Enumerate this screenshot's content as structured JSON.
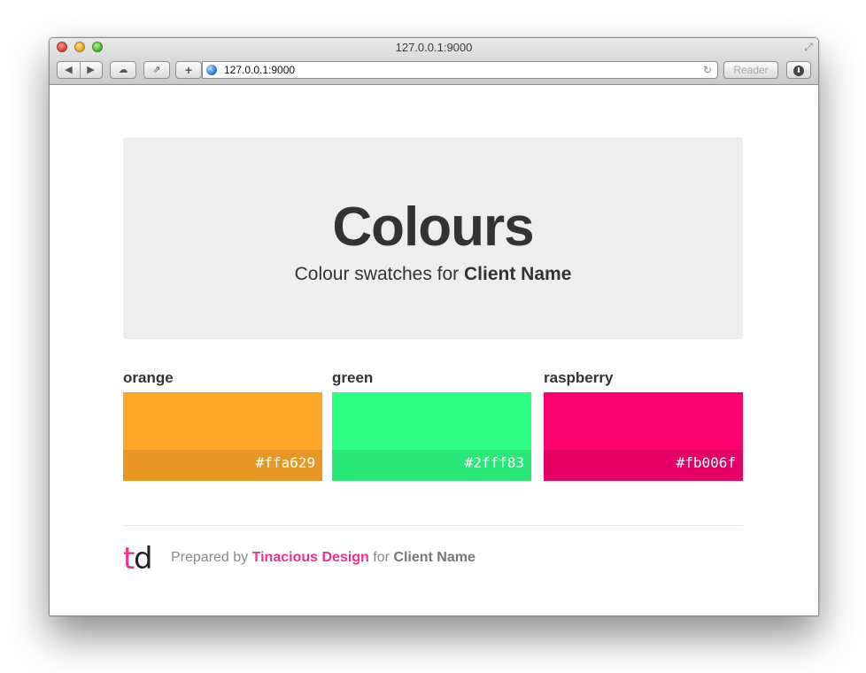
{
  "browser": {
    "window_title": "127.0.0.1:9000",
    "url": "127.0.0.1:9000",
    "reader_label": "Reader",
    "add_label": "+",
    "back_icon": "◀",
    "forward_icon": "▶",
    "cloud_icon": "☁",
    "share_icon": "⇗",
    "reload_icon": "↻",
    "download_icon": "⬇",
    "fullscreen_icon": "⤢"
  },
  "hero": {
    "title": "Colours",
    "subtitle_prefix": "Colour swatches for",
    "client": "Client Name"
  },
  "swatches": [
    {
      "name": "orange",
      "hex": "#ffa629",
      "color": "#ffa629"
    },
    {
      "name": "green",
      "hex": "#2fff83",
      "color": "#2fff83"
    },
    {
      "name": "raspberry",
      "hex": "#fb006f",
      "color": "#fb006f"
    }
  ],
  "footer": {
    "logo_t": "t",
    "logo_d": "d",
    "prepared_by": "Prepared by",
    "brand": "Tinacious Design",
    "for": "for",
    "client": "Client Name",
    "brand_color": "#ef2f88"
  }
}
